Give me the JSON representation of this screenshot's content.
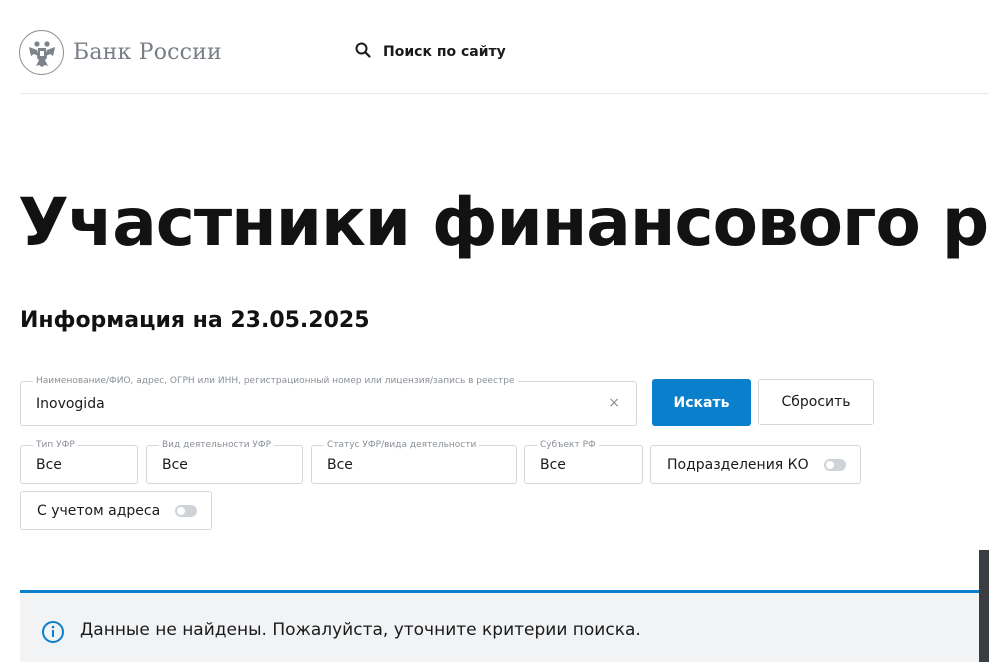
{
  "header": {
    "logo_text": "Банк России",
    "search_label": "Поиск по сайту"
  },
  "page": {
    "title": "Участники финансового рынка",
    "info_date": "Информация на 23.05.2025"
  },
  "search": {
    "query_legend": "Наименование/ФИО, адрес, ОГРН или ИНН, регистрационный номер или лицензия/запись в реестре",
    "query_value": "Inovogida",
    "clear_symbol": "×",
    "search_button": "Искать",
    "reset_button": "Сбросить"
  },
  "filters": {
    "type_legend": "Тип УФР",
    "type_value": "Все",
    "activity_legend": "Вид деятельности УФР",
    "activity_value": "Все",
    "status_legend": "Статус УФР/вида деятельности",
    "status_value": "Все",
    "region_legend": "Субъект РФ",
    "region_value": "Все",
    "branches_toggle_label": "Подразделения КО",
    "branches_toggle_on": false,
    "address_toggle_label": "С учетом адреса",
    "address_toggle_on": false
  },
  "notice": {
    "icon": "info-icon",
    "text": "Данные не найдены. Пожалуйста, уточните критерии поиска."
  },
  "colors": {
    "accent": "#0a7fcb",
    "notice_bg": "#f1f3f5",
    "logo_gray": "#777e86"
  }
}
